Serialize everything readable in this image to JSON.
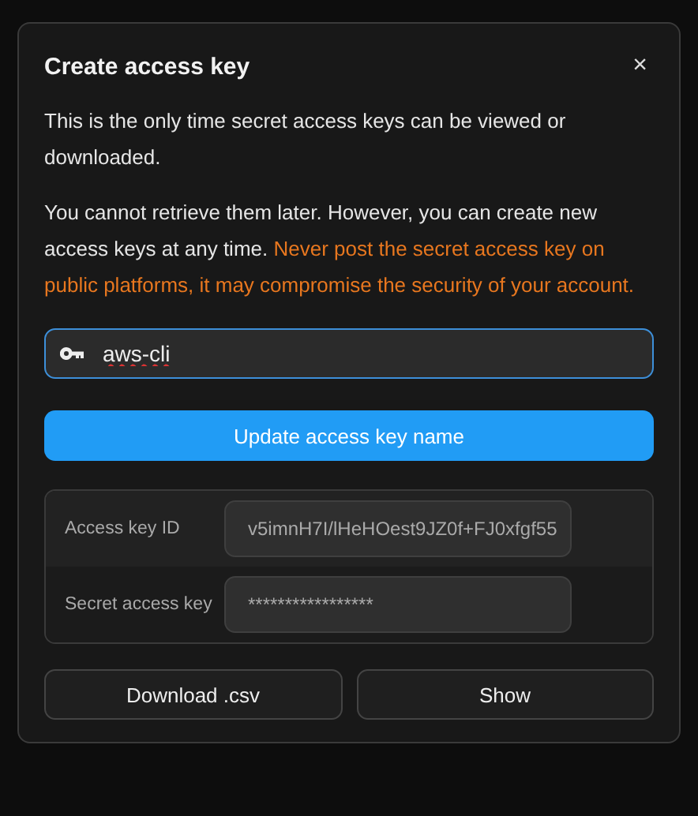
{
  "dialog": {
    "title": "Create access key",
    "close": "×"
  },
  "paragraphs": [
    {
      "text": "This is the only time secret access keys can be viewed or downloaded."
    },
    {
      "text": "You cannot retrieve them later. However, you can create new access keys at any time.",
      "warning": "Never post the secret access key on public platforms, it may compromise the security of your account."
    }
  ],
  "name_field": {
    "value": "aws-cli",
    "focused": true
  },
  "update_button": "Update access key name",
  "keys": [
    {
      "label": "Access key ID",
      "value": "v5imnH7I/lHeHOest9JZ0f+FJ0xfgf55"
    },
    {
      "label": "Secret access key",
      "value": "*****************"
    }
  ],
  "buttons": [
    "Download .csv",
    "Show"
  ]
}
